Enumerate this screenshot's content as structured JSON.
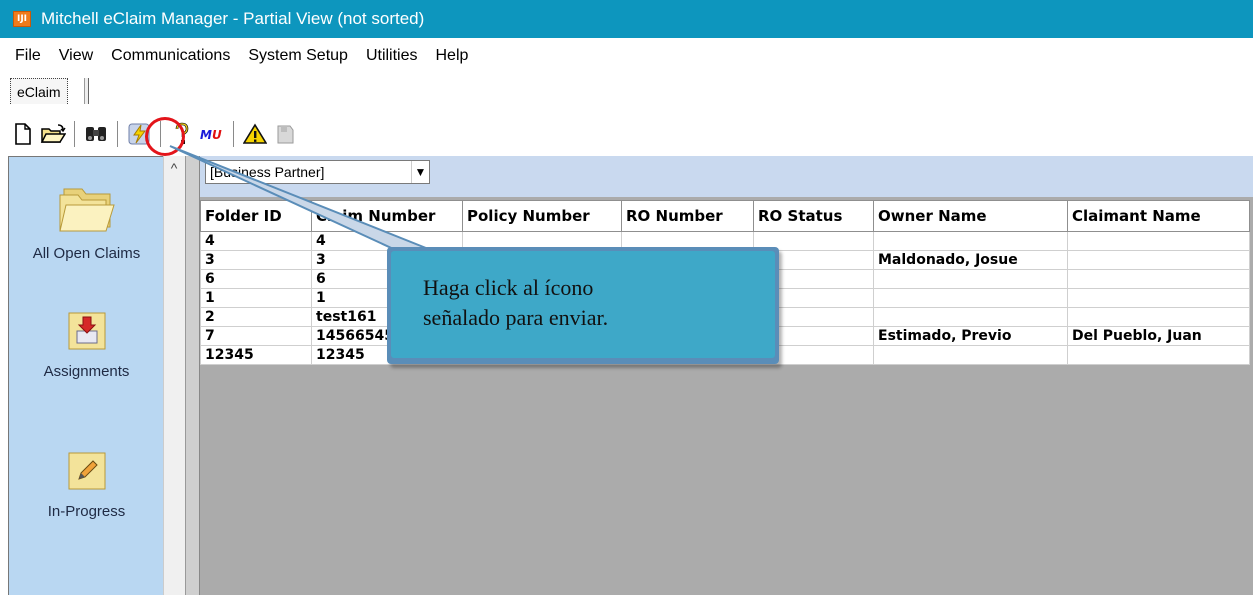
{
  "window": {
    "title": "Mitchell eClaim Manager - Partial View (not sorted)",
    "app_icon_text": "IJI"
  },
  "menu": [
    "File",
    "View",
    "Communications",
    "System Setup",
    "Utilities",
    "Help"
  ],
  "tabs": [
    {
      "label": "eClaim"
    }
  ],
  "toolbar": {
    "buttons": [
      "new-document-icon",
      "open-folder-icon",
      "binoculars-icon",
      "send-lightning-icon",
      "help-icon",
      "mu-icon",
      "warning-icon",
      "tag-icon"
    ],
    "highlight_color": "#e3141a"
  },
  "sidebar": {
    "items": [
      {
        "label": "All Open Claims"
      },
      {
        "label": "Assignments"
      },
      {
        "label": "In-Progress"
      }
    ]
  },
  "filter": {
    "selected": "[Business Partner]"
  },
  "grid": {
    "columns": [
      "Folder ID",
      "Claim Number",
      "Policy Number",
      "RO Number",
      "RO Status",
      "Owner Name",
      "Claimant Name"
    ],
    "rows": [
      [
        "4",
        "4",
        "",
        "",
        "",
        "",
        ""
      ],
      [
        "3",
        "3",
        "",
        "",
        "",
        "Maldonado, Josue",
        ""
      ],
      [
        "6",
        "6",
        "",
        "",
        "",
        "",
        ""
      ],
      [
        "1",
        "1",
        "",
        "",
        "",
        "",
        ""
      ],
      [
        "2",
        "test161",
        "",
        "",
        "",
        "",
        ""
      ],
      [
        "7",
        "145665451",
        "",
        "",
        "",
        "Estimado, Previo",
        "Del Pueblo, Juan"
      ],
      [
        "12345",
        "12345",
        "",
        "",
        "",
        "",
        ""
      ]
    ]
  },
  "callout": {
    "text_line1": "Haga click al ícono",
    "text_line2": "señalado para enviar."
  },
  "colors": {
    "titlebar": "#0d96be",
    "sidebar": "#b9d7f2",
    "callout": "#3ea8c8"
  }
}
